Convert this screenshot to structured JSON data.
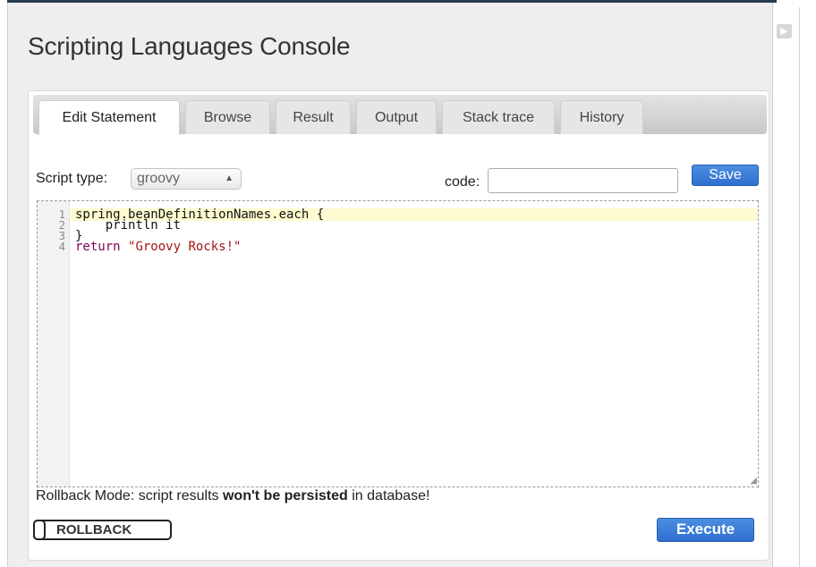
{
  "page": {
    "title": "Scripting Languages Console",
    "collapse_glyph": "▶"
  },
  "tabs": [
    {
      "label": "Edit Statement",
      "active": true
    },
    {
      "label": "Browse"
    },
    {
      "label": "Result"
    },
    {
      "label": "Output"
    },
    {
      "label": "Stack trace"
    },
    {
      "label": "History"
    }
  ],
  "form": {
    "script_type_label": "Script type:",
    "script_type_value": "groovy",
    "code_label": "code:",
    "code_value": "",
    "save_label": "Save"
  },
  "editor": {
    "line_numbers": [
      "1",
      "2",
      "3",
      "4"
    ],
    "lines": [
      {
        "plain": "spring.beanDefinitionNames.each {"
      },
      {
        "plain": "    println it"
      },
      {
        "plain": "}"
      },
      {
        "keyword": "return",
        "string": "\"Groovy Rocks!\""
      }
    ]
  },
  "rollback": {
    "note_prefix": "Rollback Mode: script results ",
    "note_bold": "won't be persisted",
    "note_suffix": " in database!",
    "toggle_label": "ROLLBACK"
  },
  "execute_label": "Execute",
  "colors": {
    "accent": "#3a7bd5",
    "active_line": "#fefbd0",
    "keyword": "#7f0055",
    "string": "#a31515"
  }
}
